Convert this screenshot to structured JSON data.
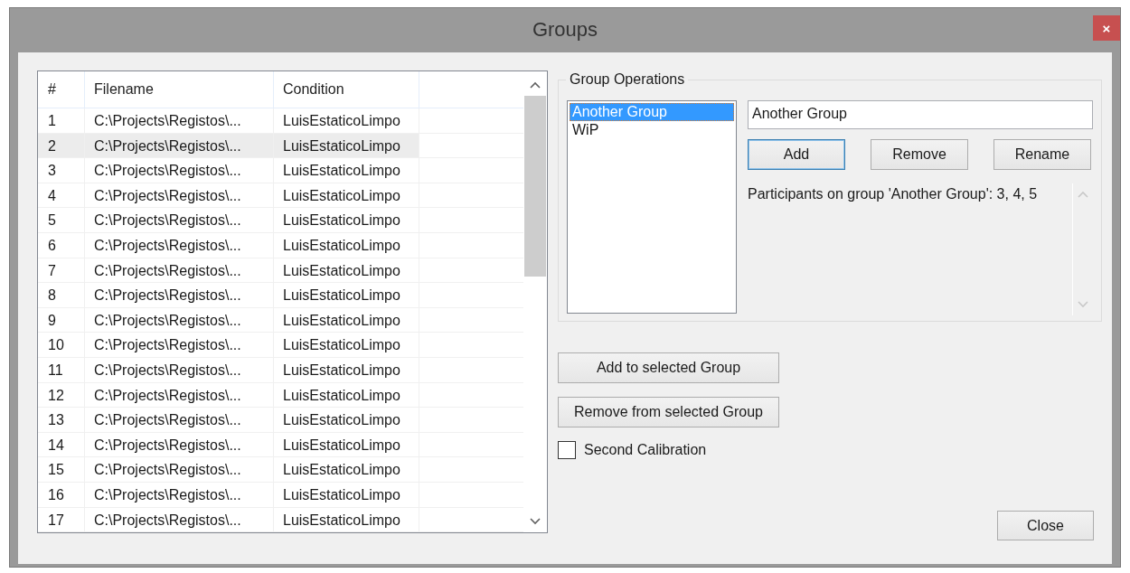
{
  "window": {
    "title": "Groups",
    "close_label": "×"
  },
  "table": {
    "columns": [
      "#",
      "Filename",
      "Condition"
    ],
    "rows": [
      {
        "number": "1",
        "filename": "C:\\Projects\\Registos\\...",
        "condition": "LuisEstaticoLimpo",
        "selected": false
      },
      {
        "number": "2",
        "filename": "C:\\Projects\\Registos\\...",
        "condition": "LuisEstaticoLimpo",
        "selected": true
      },
      {
        "number": "3",
        "filename": "C:\\Projects\\Registos\\...",
        "condition": "LuisEstaticoLimpo",
        "selected": false
      },
      {
        "number": "4",
        "filename": "C:\\Projects\\Registos\\...",
        "condition": "LuisEstaticoLimpo",
        "selected": false
      },
      {
        "number": "5",
        "filename": "C:\\Projects\\Registos\\...",
        "condition": "LuisEstaticoLimpo",
        "selected": false
      },
      {
        "number": "6",
        "filename": "C:\\Projects\\Registos\\...",
        "condition": "LuisEstaticoLimpo",
        "selected": false
      },
      {
        "number": "7",
        "filename": "C:\\Projects\\Registos\\...",
        "condition": "LuisEstaticoLimpo",
        "selected": false
      },
      {
        "number": "8",
        "filename": "C:\\Projects\\Registos\\...",
        "condition": "LuisEstaticoLimpo",
        "selected": false
      },
      {
        "number": "9",
        "filename": "C:\\Projects\\Registos\\...",
        "condition": "LuisEstaticoLimpo",
        "selected": false
      },
      {
        "number": "10",
        "filename": "C:\\Projects\\Registos\\...",
        "condition": "LuisEstaticoLimpo",
        "selected": false
      },
      {
        "number": "11",
        "filename": "C:\\Projects\\Registos\\...",
        "condition": "LuisEstaticoLimpo",
        "selected": false
      },
      {
        "number": "12",
        "filename": "C:\\Projects\\Registos\\...",
        "condition": "LuisEstaticoLimpo",
        "selected": false
      },
      {
        "number": "13",
        "filename": "C:\\Projects\\Registos\\...",
        "condition": "LuisEstaticoLimpo",
        "selected": false
      },
      {
        "number": "14",
        "filename": "C:\\Projects\\Registos\\...",
        "condition": "LuisEstaticoLimpo",
        "selected": false
      },
      {
        "number": "15",
        "filename": "C:\\Projects\\Registos\\...",
        "condition": "LuisEstaticoLimpo",
        "selected": false
      },
      {
        "number": "16",
        "filename": "C:\\Projects\\Registos\\...",
        "condition": "LuisEstaticoLimpo",
        "selected": false
      },
      {
        "number": "17",
        "filename": "C:\\Projects\\Registos\\...",
        "condition": "LuisEstaticoLimpo",
        "selected": false
      }
    ]
  },
  "group_operations": {
    "title": "Group Operations",
    "groups": [
      {
        "label": "Another Group",
        "selected": true
      },
      {
        "label": "WiP",
        "selected": false
      }
    ],
    "name_field": {
      "value": "Another Group"
    },
    "buttons": [
      {
        "label": "Add",
        "focused": true
      },
      {
        "label": "Remove",
        "focused": false
      },
      {
        "label": "Rename",
        "focused": false
      }
    ],
    "participants": "Participants on group 'Another Group': 3, 4, 5"
  },
  "actions": [
    {
      "label": "Add to selected Group"
    },
    {
      "label": "Remove from selected Group"
    }
  ],
  "second_calibration": {
    "label": "Second Calibration",
    "checked": false
  },
  "close_button": {
    "label": "Close"
  }
}
